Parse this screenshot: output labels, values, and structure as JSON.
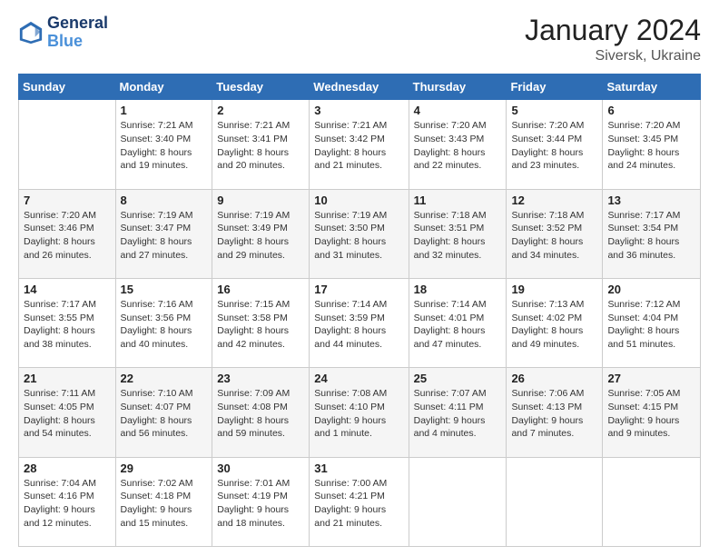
{
  "logo": {
    "line1": "General",
    "line2": "Blue"
  },
  "header": {
    "month_year": "January 2024",
    "location": "Siversk, Ukraine"
  },
  "weekdays": [
    "Sunday",
    "Monday",
    "Tuesday",
    "Wednesday",
    "Thursday",
    "Friday",
    "Saturday"
  ],
  "weeks": [
    [
      {
        "day": "",
        "sunrise": "",
        "sunset": "",
        "daylight": ""
      },
      {
        "day": "1",
        "sunrise": "Sunrise: 7:21 AM",
        "sunset": "Sunset: 3:40 PM",
        "daylight": "Daylight: 8 hours and 19 minutes."
      },
      {
        "day": "2",
        "sunrise": "Sunrise: 7:21 AM",
        "sunset": "Sunset: 3:41 PM",
        "daylight": "Daylight: 8 hours and 20 minutes."
      },
      {
        "day": "3",
        "sunrise": "Sunrise: 7:21 AM",
        "sunset": "Sunset: 3:42 PM",
        "daylight": "Daylight: 8 hours and 21 minutes."
      },
      {
        "day": "4",
        "sunrise": "Sunrise: 7:20 AM",
        "sunset": "Sunset: 3:43 PM",
        "daylight": "Daylight: 8 hours and 22 minutes."
      },
      {
        "day": "5",
        "sunrise": "Sunrise: 7:20 AM",
        "sunset": "Sunset: 3:44 PM",
        "daylight": "Daylight: 8 hours and 23 minutes."
      },
      {
        "day": "6",
        "sunrise": "Sunrise: 7:20 AM",
        "sunset": "Sunset: 3:45 PM",
        "daylight": "Daylight: 8 hours and 24 minutes."
      }
    ],
    [
      {
        "day": "7",
        "sunrise": "Sunrise: 7:20 AM",
        "sunset": "Sunset: 3:46 PM",
        "daylight": "Daylight: 8 hours and 26 minutes."
      },
      {
        "day": "8",
        "sunrise": "Sunrise: 7:19 AM",
        "sunset": "Sunset: 3:47 PM",
        "daylight": "Daylight: 8 hours and 27 minutes."
      },
      {
        "day": "9",
        "sunrise": "Sunrise: 7:19 AM",
        "sunset": "Sunset: 3:49 PM",
        "daylight": "Daylight: 8 hours and 29 minutes."
      },
      {
        "day": "10",
        "sunrise": "Sunrise: 7:19 AM",
        "sunset": "Sunset: 3:50 PM",
        "daylight": "Daylight: 8 hours and 31 minutes."
      },
      {
        "day": "11",
        "sunrise": "Sunrise: 7:18 AM",
        "sunset": "Sunset: 3:51 PM",
        "daylight": "Daylight: 8 hours and 32 minutes."
      },
      {
        "day": "12",
        "sunrise": "Sunrise: 7:18 AM",
        "sunset": "Sunset: 3:52 PM",
        "daylight": "Daylight: 8 hours and 34 minutes."
      },
      {
        "day": "13",
        "sunrise": "Sunrise: 7:17 AM",
        "sunset": "Sunset: 3:54 PM",
        "daylight": "Daylight: 8 hours and 36 minutes."
      }
    ],
    [
      {
        "day": "14",
        "sunrise": "Sunrise: 7:17 AM",
        "sunset": "Sunset: 3:55 PM",
        "daylight": "Daylight: 8 hours and 38 minutes."
      },
      {
        "day": "15",
        "sunrise": "Sunrise: 7:16 AM",
        "sunset": "Sunset: 3:56 PM",
        "daylight": "Daylight: 8 hours and 40 minutes."
      },
      {
        "day": "16",
        "sunrise": "Sunrise: 7:15 AM",
        "sunset": "Sunset: 3:58 PM",
        "daylight": "Daylight: 8 hours and 42 minutes."
      },
      {
        "day": "17",
        "sunrise": "Sunrise: 7:14 AM",
        "sunset": "Sunset: 3:59 PM",
        "daylight": "Daylight: 8 hours and 44 minutes."
      },
      {
        "day": "18",
        "sunrise": "Sunrise: 7:14 AM",
        "sunset": "Sunset: 4:01 PM",
        "daylight": "Daylight: 8 hours and 47 minutes."
      },
      {
        "day": "19",
        "sunrise": "Sunrise: 7:13 AM",
        "sunset": "Sunset: 4:02 PM",
        "daylight": "Daylight: 8 hours and 49 minutes."
      },
      {
        "day": "20",
        "sunrise": "Sunrise: 7:12 AM",
        "sunset": "Sunset: 4:04 PM",
        "daylight": "Daylight: 8 hours and 51 minutes."
      }
    ],
    [
      {
        "day": "21",
        "sunrise": "Sunrise: 7:11 AM",
        "sunset": "Sunset: 4:05 PM",
        "daylight": "Daylight: 8 hours and 54 minutes."
      },
      {
        "day": "22",
        "sunrise": "Sunrise: 7:10 AM",
        "sunset": "Sunset: 4:07 PM",
        "daylight": "Daylight: 8 hours and 56 minutes."
      },
      {
        "day": "23",
        "sunrise": "Sunrise: 7:09 AM",
        "sunset": "Sunset: 4:08 PM",
        "daylight": "Daylight: 8 hours and 59 minutes."
      },
      {
        "day": "24",
        "sunrise": "Sunrise: 7:08 AM",
        "sunset": "Sunset: 4:10 PM",
        "daylight": "Daylight: 9 hours and 1 minute."
      },
      {
        "day": "25",
        "sunrise": "Sunrise: 7:07 AM",
        "sunset": "Sunset: 4:11 PM",
        "daylight": "Daylight: 9 hours and 4 minutes."
      },
      {
        "day": "26",
        "sunrise": "Sunrise: 7:06 AM",
        "sunset": "Sunset: 4:13 PM",
        "daylight": "Daylight: 9 hours and 7 minutes."
      },
      {
        "day": "27",
        "sunrise": "Sunrise: 7:05 AM",
        "sunset": "Sunset: 4:15 PM",
        "daylight": "Daylight: 9 hours and 9 minutes."
      }
    ],
    [
      {
        "day": "28",
        "sunrise": "Sunrise: 7:04 AM",
        "sunset": "Sunset: 4:16 PM",
        "daylight": "Daylight: 9 hours and 12 minutes."
      },
      {
        "day": "29",
        "sunrise": "Sunrise: 7:02 AM",
        "sunset": "Sunset: 4:18 PM",
        "daylight": "Daylight: 9 hours and 15 minutes."
      },
      {
        "day": "30",
        "sunrise": "Sunrise: 7:01 AM",
        "sunset": "Sunset: 4:19 PM",
        "daylight": "Daylight: 9 hours and 18 minutes."
      },
      {
        "day": "31",
        "sunrise": "Sunrise: 7:00 AM",
        "sunset": "Sunset: 4:21 PM",
        "daylight": "Daylight: 9 hours and 21 minutes."
      },
      {
        "day": "",
        "sunrise": "",
        "sunset": "",
        "daylight": ""
      },
      {
        "day": "",
        "sunrise": "",
        "sunset": "",
        "daylight": ""
      },
      {
        "day": "",
        "sunrise": "",
        "sunset": "",
        "daylight": ""
      }
    ]
  ]
}
